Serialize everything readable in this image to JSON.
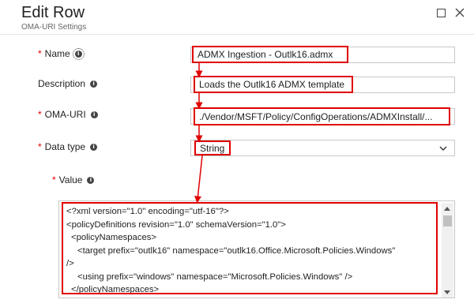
{
  "header": {
    "title": "Edit Row",
    "subtitle": "OMA-URI Settings"
  },
  "form": {
    "name": {
      "label": "Name",
      "required": "*",
      "value": "ADMX Ingestion - Outlk16.admx"
    },
    "description": {
      "label": "Description",
      "value": "Loads the Outlk16 ADMX template"
    },
    "oma_uri": {
      "label": "OMA-URI",
      "required": "*",
      "value": "./Vendor/MSFT/Policy/ConfigOperations/ADMXInstall/..."
    },
    "data_type": {
      "label": "Data type",
      "required": "*",
      "value": "String"
    },
    "value": {
      "label": "Value",
      "required": "*",
      "lines": [
        "<?xml version=\"1.0\" encoding=\"utf-16\"?>",
        "<policyDefinitions revision=\"1.0\" schemaVersion=\"1.0\">",
        "<policyNamespaces>",
        "<target prefix=\"outlk16\" namespace=\"outlk16.Office.Microsoft.Policies.Windows\"",
        "/>",
        "<using prefix=\"windows\" namespace=\"Microsoft.Policies.Windows\" />",
        "</policyNamespaces>"
      ]
    }
  },
  "info_glyph": "i",
  "colors": {
    "highlight": "#e00000",
    "required": "#e00000"
  }
}
